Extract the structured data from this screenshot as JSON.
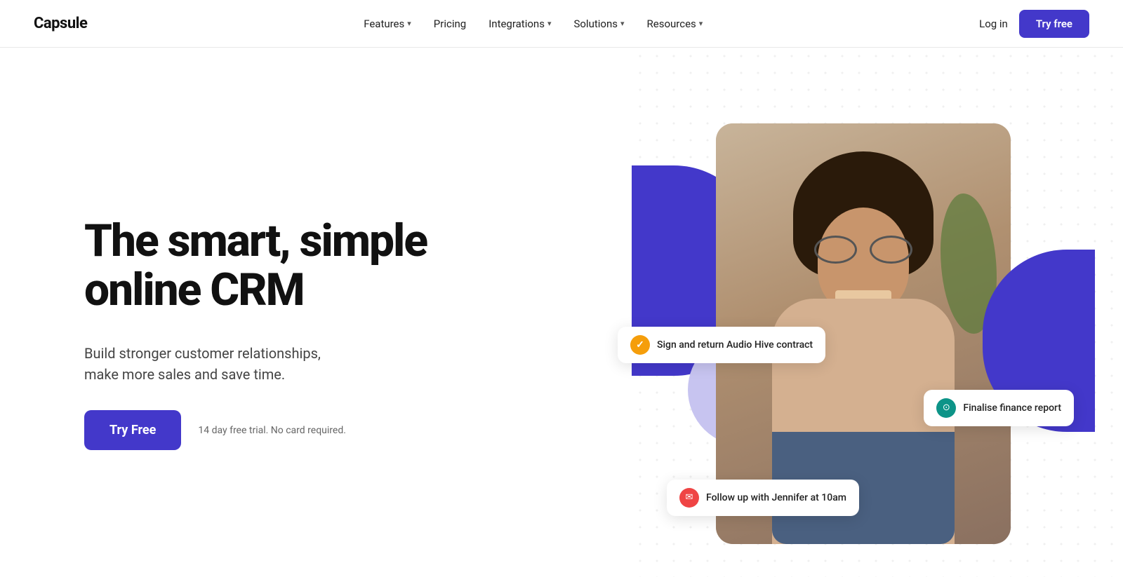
{
  "brand": {
    "name": "Capsule"
  },
  "nav": {
    "links": [
      {
        "label": "Features",
        "hasDropdown": true
      },
      {
        "label": "Pricing",
        "hasDropdown": false
      },
      {
        "label": "Integrations",
        "hasDropdown": true
      },
      {
        "label": "Solutions",
        "hasDropdown": true
      },
      {
        "label": "Resources",
        "hasDropdown": true
      }
    ],
    "login_label": "Log in",
    "try_free_label": "Try free"
  },
  "hero": {
    "headline_line1": "The smart, simple",
    "headline_line2": "online CRM",
    "subtext_line1": "Build stronger customer relationships,",
    "subtext_line2": "make more sales and save time.",
    "cta_label": "Try Free",
    "trial_text": "14 day free trial. No card required."
  },
  "notifications": [
    {
      "id": "notif-1",
      "icon_type": "yellow",
      "icon_char": "✓",
      "text": "Sign and return Audio Hive contract"
    },
    {
      "id": "notif-2",
      "icon_type": "teal",
      "icon_char": "⏱",
      "text": "Finalise finance report"
    },
    {
      "id": "notif-3",
      "icon_type": "red",
      "icon_char": "✉",
      "text": "Follow up with Jennifer at 10am"
    }
  ],
  "colors": {
    "brand_purple": "#4338ca",
    "brand_purple_light": "#c7c4f0"
  }
}
